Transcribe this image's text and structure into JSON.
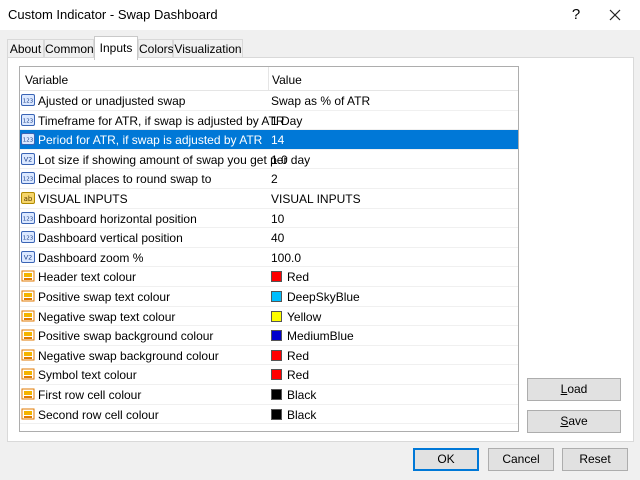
{
  "window": {
    "title": "Custom Indicator - Swap Dashboard",
    "help_label": "?"
  },
  "tabs": [
    {
      "label": "About"
    },
    {
      "label": "Common"
    },
    {
      "label": "Inputs"
    },
    {
      "label": "Colors"
    },
    {
      "label": "Visualization"
    }
  ],
  "active_tab": "Inputs",
  "grid": {
    "headers": {
      "variable": "Variable",
      "value": "Value"
    },
    "selected_row": 2,
    "rows": [
      {
        "icon": "123",
        "variable": "Ajusted or unadjusted swap",
        "value": "Swap as % of ATR"
      },
      {
        "icon": "123",
        "variable": "Timeframe for ATR, if swap is adjusted by ATR",
        "value": "1 Day"
      },
      {
        "icon": "123",
        "variable": "Period for ATR, if swap is adjusted by ATR",
        "value": "14"
      },
      {
        "icon": "V2",
        "variable": "Lot size if showing amount of swap you get per day",
        "value": "1.0"
      },
      {
        "icon": "123",
        "variable": "Decimal places to round swap to",
        "value": "2"
      },
      {
        "icon": "ab",
        "variable": "VISUAL INPUTS",
        "value": "VISUAL INPUTS"
      },
      {
        "icon": "123",
        "variable": "Dashboard horizontal position",
        "value": "10"
      },
      {
        "icon": "123",
        "variable": "Dashboard vertical position",
        "value": "40"
      },
      {
        "icon": "V2",
        "variable": "Dashboard zoom %",
        "value": "100.0"
      },
      {
        "icon": "color",
        "variable": "Header text colour",
        "value": "Red",
        "swatch": "#ff0000"
      },
      {
        "icon": "color",
        "variable": "Positive swap text colour",
        "value": "DeepSkyBlue",
        "swatch": "#00bfff"
      },
      {
        "icon": "color",
        "variable": "Negative swap text colour",
        "value": "Yellow",
        "swatch": "#ffff00"
      },
      {
        "icon": "color",
        "variable": "Positive swap background colour",
        "value": "MediumBlue",
        "swatch": "#0000cd"
      },
      {
        "icon": "color",
        "variable": "Negative swap background colour",
        "value": "Red",
        "swatch": "#ff0000"
      },
      {
        "icon": "color",
        "variable": "Symbol text colour",
        "value": "Red",
        "swatch": "#ff0000"
      },
      {
        "icon": "color",
        "variable": "First row cell colour",
        "value": "Black",
        "swatch": "#000000"
      },
      {
        "icon": "color",
        "variable": "Second row cell colour",
        "value": "Black",
        "swatch": "#000000"
      }
    ]
  },
  "side_buttons": {
    "load": {
      "prefix": "",
      "accel": "L",
      "rest": "oad"
    },
    "save": {
      "prefix": "",
      "accel": "S",
      "rest": "ave"
    }
  },
  "footer_buttons": {
    "ok": "OK",
    "cancel": "Cancel",
    "reset": "Reset"
  },
  "colors": {
    "selection": "#0078d7",
    "accent": "#0078d7"
  }
}
